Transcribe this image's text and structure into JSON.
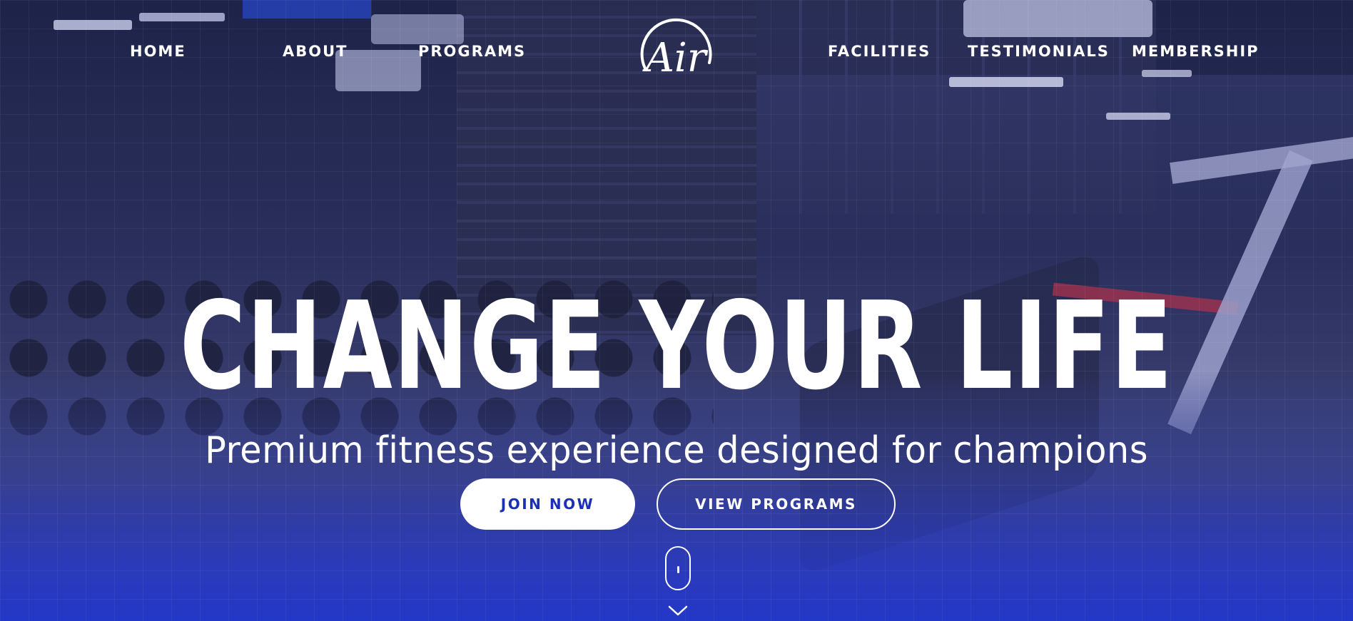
{
  "nav": {
    "home": "HOME",
    "about": "ABOUT",
    "programs": "PROGRAMS",
    "facilities": "FACILITIES",
    "testimonials": "TESTIMONIALS",
    "membership": "MEMBERSHIP"
  },
  "logo": {
    "text": "Air",
    "icon": "air-logo"
  },
  "hero": {
    "headline": "CHANGE YOUR LIFE",
    "subheadline": "Premium fitness experience designed for champions"
  },
  "buttons": {
    "join": "JOIN NOW",
    "view_programs": "VIEW PROGRAMS"
  },
  "scroll_indicator": {
    "mouse_icon": "mouse-scroll-icon",
    "chevron_icon": "chevron-down-icon"
  },
  "colors": {
    "accent_blue": "#1c2fb8",
    "text": "#ffffff"
  }
}
